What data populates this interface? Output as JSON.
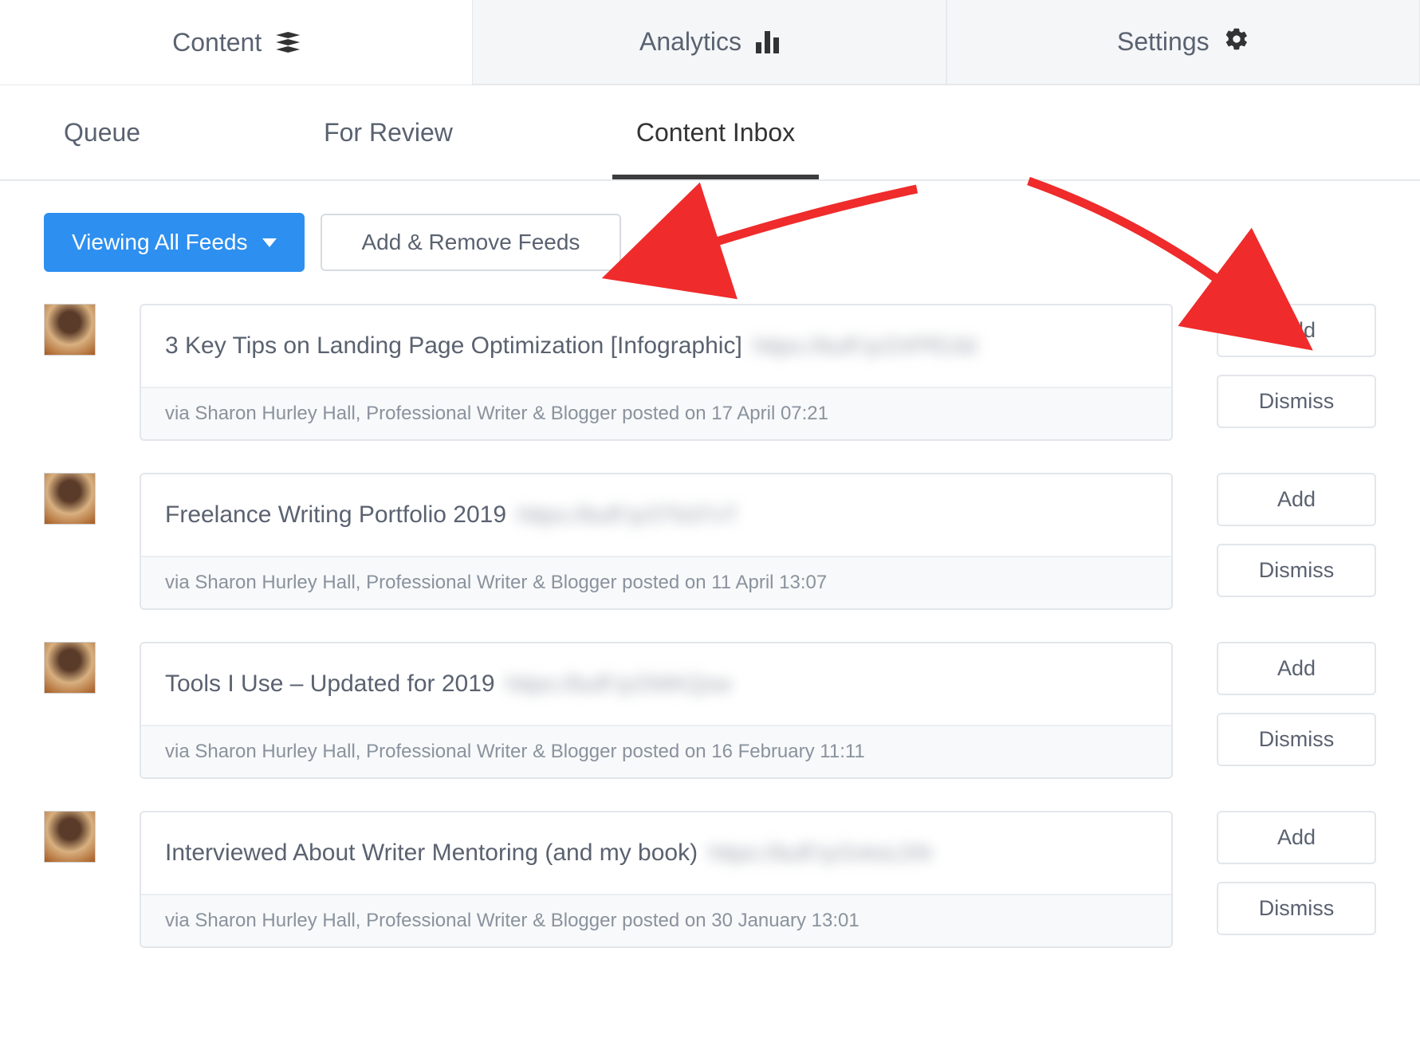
{
  "top_nav": {
    "content_label": "Content",
    "analytics_label": "Analytics",
    "settings_label": "Settings"
  },
  "sub_nav": {
    "queue": "Queue",
    "for_review": "For Review",
    "content_inbox": "Content Inbox"
  },
  "controls": {
    "viewing_label": "Viewing All Feeds",
    "add_remove_label": "Add & Remove Feeds"
  },
  "button_labels": {
    "add": "Add",
    "dismiss": "Dismiss"
  },
  "feed": [
    {
      "title": "3 Key Tips on Landing Page Optimization [Infographic]",
      "obscured_link": "https://buff.ly/2XPfG3d",
      "meta": "via Sharon Hurley Hall, Professional Writer & Blogger posted on 17 April 07:21"
    },
    {
      "title": "Freelance Writing Portfolio 2019",
      "obscured_link": "https://buff.ly/2Tb37vT",
      "meta": "via Sharon Hurley Hall, Professional Writer & Blogger posted on 11 April 13:07"
    },
    {
      "title": "Tools I Use – Updated for 2019",
      "obscured_link": "https://buff.ly/2WKQsw",
      "meta": "via Sharon Hurley Hall, Professional Writer & Blogger posted on 16 February 11:11"
    },
    {
      "title": "Interviewed About Writer Mentoring (and my book)",
      "obscured_link": "https://buff.ly/2vksLDN",
      "meta": "via Sharon Hurley Hall, Professional Writer & Blogger posted on 30 January 13:01"
    }
  ]
}
